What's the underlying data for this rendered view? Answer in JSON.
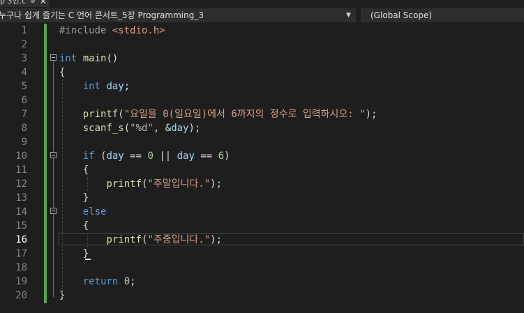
{
  "tab": {
    "filename": "p 3번.c",
    "pin_icon": "pin-icon",
    "close_icon": "close-icon"
  },
  "navbar": {
    "project": "누구나 쉽게 즐기는 C 언어 콘서트_5장 Programming_3",
    "scope": "(Global Scope)"
  },
  "editor": {
    "current_line": 16,
    "lines": [
      {
        "n": "1",
        "tokens": [
          {
            "t": "#include ",
            "c": "pre"
          },
          {
            "t": "<stdio.h>",
            "c": "inc"
          }
        ]
      },
      {
        "n": "2",
        "tokens": []
      },
      {
        "n": "3",
        "tokens": [
          {
            "t": "int ",
            "c": "kw"
          },
          {
            "t": "main",
            "c": "fn"
          },
          {
            "t": "()",
            "c": ""
          }
        ]
      },
      {
        "n": "4",
        "tokens": [
          {
            "t": "{",
            "c": ""
          }
        ]
      },
      {
        "n": "5",
        "tokens": [
          {
            "t": "    ",
            "c": ""
          },
          {
            "t": "int ",
            "c": "kw"
          },
          {
            "t": "day",
            "c": "var"
          },
          {
            "t": ";",
            "c": ""
          }
        ]
      },
      {
        "n": "6",
        "tokens": []
      },
      {
        "n": "7",
        "tokens": [
          {
            "t": "    ",
            "c": ""
          },
          {
            "t": "printf",
            "c": "fn"
          },
          {
            "t": "(",
            "c": ""
          },
          {
            "t": "\"요일을 0(일요일)에서 6까지의 정수로 입력하시오: \"",
            "c": "str"
          },
          {
            "t": ");",
            "c": ""
          }
        ]
      },
      {
        "n": "8",
        "tokens": [
          {
            "t": "    ",
            "c": ""
          },
          {
            "t": "scanf_s",
            "c": "fn"
          },
          {
            "t": "(",
            "c": ""
          },
          {
            "t": "\"",
            "c": "str"
          },
          {
            "t": "%d",
            "c": "fmt"
          },
          {
            "t": "\"",
            "c": "str"
          },
          {
            "t": ", &",
            "c": ""
          },
          {
            "t": "day",
            "c": "var"
          },
          {
            "t": ");",
            "c": ""
          }
        ]
      },
      {
        "n": "9",
        "tokens": []
      },
      {
        "n": "10",
        "tokens": [
          {
            "t": "    ",
            "c": ""
          },
          {
            "t": "if",
            "c": "kw"
          },
          {
            "t": " (",
            "c": ""
          },
          {
            "t": "day",
            "c": "var"
          },
          {
            "t": " == ",
            "c": ""
          },
          {
            "t": "0",
            "c": "num"
          },
          {
            "t": " || ",
            "c": ""
          },
          {
            "t": "day",
            "c": "var"
          },
          {
            "t": " == ",
            "c": ""
          },
          {
            "t": "6",
            "c": "num"
          },
          {
            "t": ")",
            "c": ""
          }
        ]
      },
      {
        "n": "11",
        "tokens": [
          {
            "t": "    {",
            "c": ""
          }
        ]
      },
      {
        "n": "12",
        "tokens": [
          {
            "t": "        ",
            "c": ""
          },
          {
            "t": "printf",
            "c": "fn"
          },
          {
            "t": "(",
            "c": ""
          },
          {
            "t": "\"주말입니다.\"",
            "c": "str"
          },
          {
            "t": ");",
            "c": ""
          }
        ]
      },
      {
        "n": "13",
        "tokens": [
          {
            "t": "    }",
            "c": ""
          }
        ]
      },
      {
        "n": "14",
        "tokens": [
          {
            "t": "    ",
            "c": ""
          },
          {
            "t": "else",
            "c": "kw"
          }
        ]
      },
      {
        "n": "15",
        "tokens": [
          {
            "t": "    {",
            "c": ""
          }
        ]
      },
      {
        "n": "16",
        "tokens": [
          {
            "t": "        ",
            "c": ""
          },
          {
            "t": "printf",
            "c": "fn"
          },
          {
            "t": "(",
            "c": ""
          },
          {
            "t": "\"주중입니다.\"",
            "c": "str"
          },
          {
            "t": ");",
            "c": ""
          }
        ]
      },
      {
        "n": "17",
        "tokens": [
          {
            "t": "    }",
            "c": ""
          }
        ]
      },
      {
        "n": "18",
        "tokens": []
      },
      {
        "n": "19",
        "tokens": [
          {
            "t": "    ",
            "c": ""
          },
          {
            "t": "return ",
            "c": "kw"
          },
          {
            "t": "0",
            "c": "num"
          },
          {
            "t": ";",
            "c": ""
          }
        ]
      },
      {
        "n": "20",
        "tokens": [
          {
            "t": "}",
            "c": ""
          }
        ]
      }
    ]
  },
  "colors": {
    "background": "#1e1e1e",
    "keyword": "#569cd6",
    "function": "#dcdcaa",
    "variable": "#9cdcfe",
    "string": "#d69d85",
    "number": "#b5cea8",
    "change_bar": "#57a64a"
  }
}
